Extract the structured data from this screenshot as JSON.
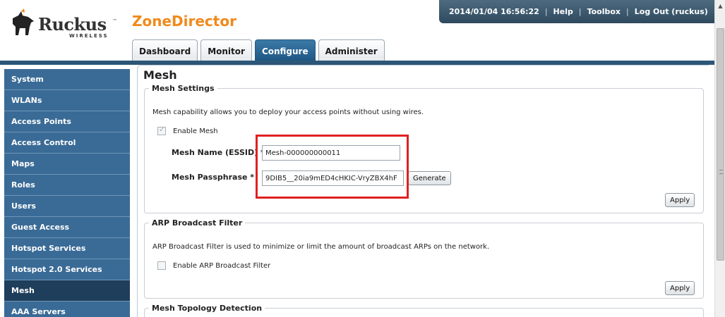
{
  "brand": {
    "logo_text": "Ruckus",
    "logo_sub": "WIRELESS",
    "logo_tm": "™",
    "app_name": "ZoneDirector"
  },
  "topbar": {
    "datetime": "2014/01/04 16:56:22",
    "help": "Help",
    "toolbox": "Toolbox",
    "logout": "Log Out (ruckus)",
    "separator": "|"
  },
  "tabs": [
    {
      "label": "Dashboard",
      "active": false
    },
    {
      "label": "Monitor",
      "active": false
    },
    {
      "label": "Configure",
      "active": true
    },
    {
      "label": "Administer",
      "active": false
    }
  ],
  "sidebar": {
    "items": [
      {
        "label": "System"
      },
      {
        "label": "WLANs"
      },
      {
        "label": "Access Points"
      },
      {
        "label": "Access Control"
      },
      {
        "label": "Maps"
      },
      {
        "label": "Roles"
      },
      {
        "label": "Users"
      },
      {
        "label": "Guest Access"
      },
      {
        "label": "Hotspot Services"
      },
      {
        "label": "Hotspot 2.0 Services"
      },
      {
        "label": "Mesh",
        "active": true
      },
      {
        "label": "AAA Servers"
      }
    ]
  },
  "main": {
    "title": "Mesh",
    "mesh_settings": {
      "legend": "Mesh Settings",
      "description": "Mesh capability allows you to deploy your access points without using wires.",
      "enable_label": "Enable Mesh",
      "enable_checked": true,
      "name_label": "Mesh Name (ESSID) *",
      "name_value": "Mesh-000000000011",
      "passphrase_label": "Mesh Passphrase *",
      "passphrase_value": "9DIB5__20ia9mED4cHKIC-VryZBX4hF",
      "generate_label": "Generate",
      "apply_label": "Apply"
    },
    "arp_filter": {
      "legend": "ARP Broadcast Filter",
      "description": "ARP Broadcast Filter is used to minimize or limit the amount of broadcast ARPs on the network.",
      "enable_label": "Enable ARP Broadcast Filter",
      "enable_checked": false,
      "apply_label": "Apply"
    },
    "topology": {
      "legend": "Mesh Topology Detection"
    }
  },
  "colors": {
    "brand_orange": "#f08a1c",
    "nav_blue": "#3a6b96",
    "nav_active": "#1f3e5b",
    "highlight_red": "#e02020"
  }
}
